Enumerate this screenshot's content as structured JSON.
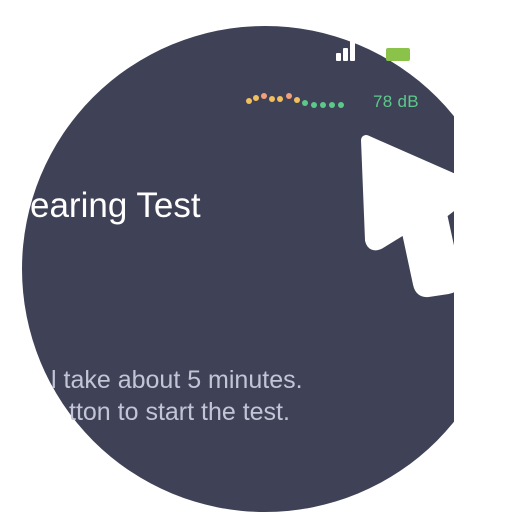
{
  "status_bar": {
    "signal_icon": "signal-bars-icon",
    "battery_icon": "battery-icon",
    "battery_color": "#8bc34a"
  },
  "sound_level": {
    "value_text": "78 dB",
    "value_color": "#5cc98a",
    "dot_colors": [
      "#f2bf5f",
      "#f2bf5f",
      "#f2a07a",
      "#f2bf5f",
      "#f2bf5f",
      "#f2a07a",
      "#f2bf5f",
      "#5cc98a",
      "#5cc98a",
      "#5cc98a",
      "#5cc98a",
      "#5cc98a"
    ]
  },
  "screen": {
    "title": "earing Test",
    "instruction_line1": "l take about 5 minutes.",
    "instruction_line2": "tton to start the test.",
    "background": "#3f4157"
  },
  "cursor": {
    "icon": "arrow-pointer-icon"
  }
}
